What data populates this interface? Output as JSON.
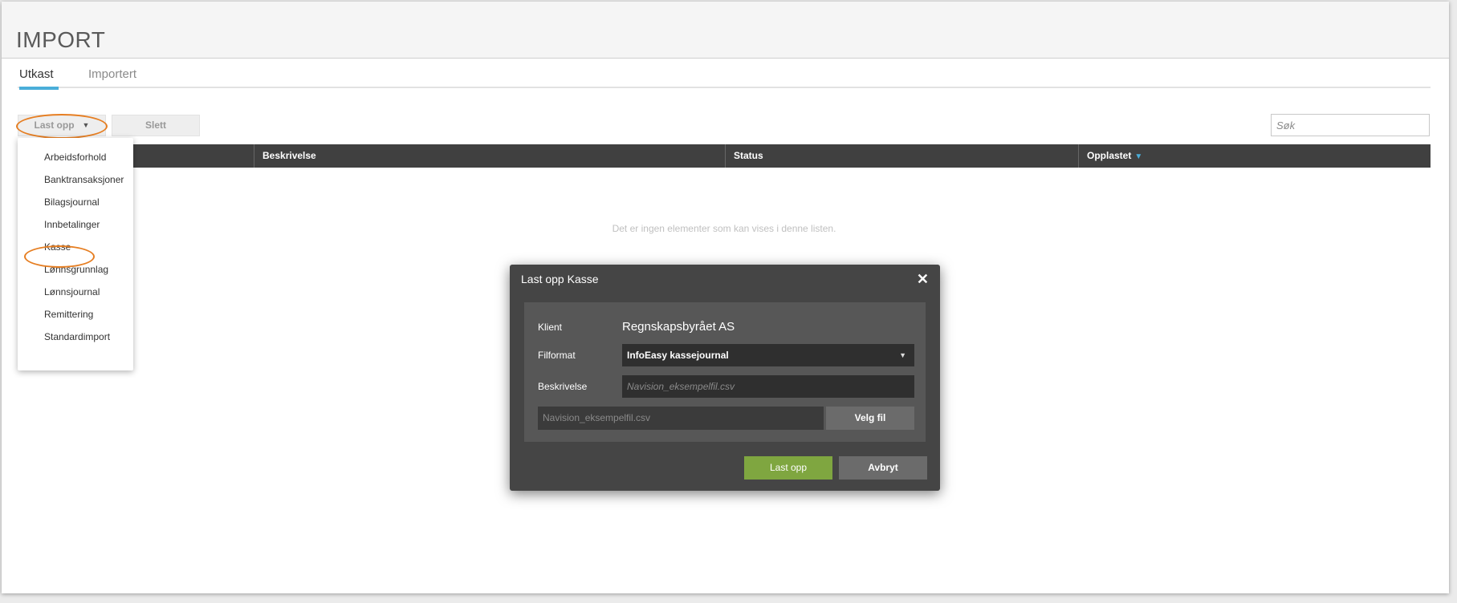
{
  "page": {
    "title": "IMPORT"
  },
  "tabs": [
    {
      "label": "Utkast",
      "active": true
    },
    {
      "label": "Importert",
      "active": false
    }
  ],
  "toolbar": {
    "upload_label": "Last opp",
    "delete_label": "Slett"
  },
  "search": {
    "placeholder": "Søk",
    "value": ""
  },
  "table": {
    "columns": [
      "",
      "Beskrivelse",
      "Status",
      "Opplastet"
    ],
    "sorted_column": "Opplastet",
    "empty_message": "Det er ingen elementer som kan vises i denne listen."
  },
  "upload_menu": {
    "items": [
      "Arbeidsforhold",
      "Banktransaksjoner",
      "Bilagsjournal",
      "Innbetalinger",
      "Kasse",
      "Lønnsgrunnlag",
      "Lønnsjournal",
      "Remittering",
      "Standardimport"
    ],
    "highlighted": "Kasse"
  },
  "modal": {
    "title": "Last opp Kasse",
    "client_label": "Klient",
    "client_value": "Regnskapsbyrået AS",
    "format_label": "Filformat",
    "format_value": "InfoEasy kassejournal",
    "description_label": "Beskrivelse",
    "description_placeholder": "Navision_eksempelfil.csv",
    "file_name": "Navision_eksempelfil.csv",
    "choose_file_label": "Velg fil",
    "upload_label": "Last opp",
    "cancel_label": "Avbryt"
  },
  "colors": {
    "accent": "#4aaed9",
    "highlight": "#e67e22",
    "primary_button": "#7fa640",
    "table_header": "#404040",
    "modal_bg": "#454545"
  },
  "icons": {
    "upload_caret": "caret-down-icon",
    "sort": "sort-down-icon",
    "close": "close-icon",
    "select_caret": "caret-down-icon"
  }
}
